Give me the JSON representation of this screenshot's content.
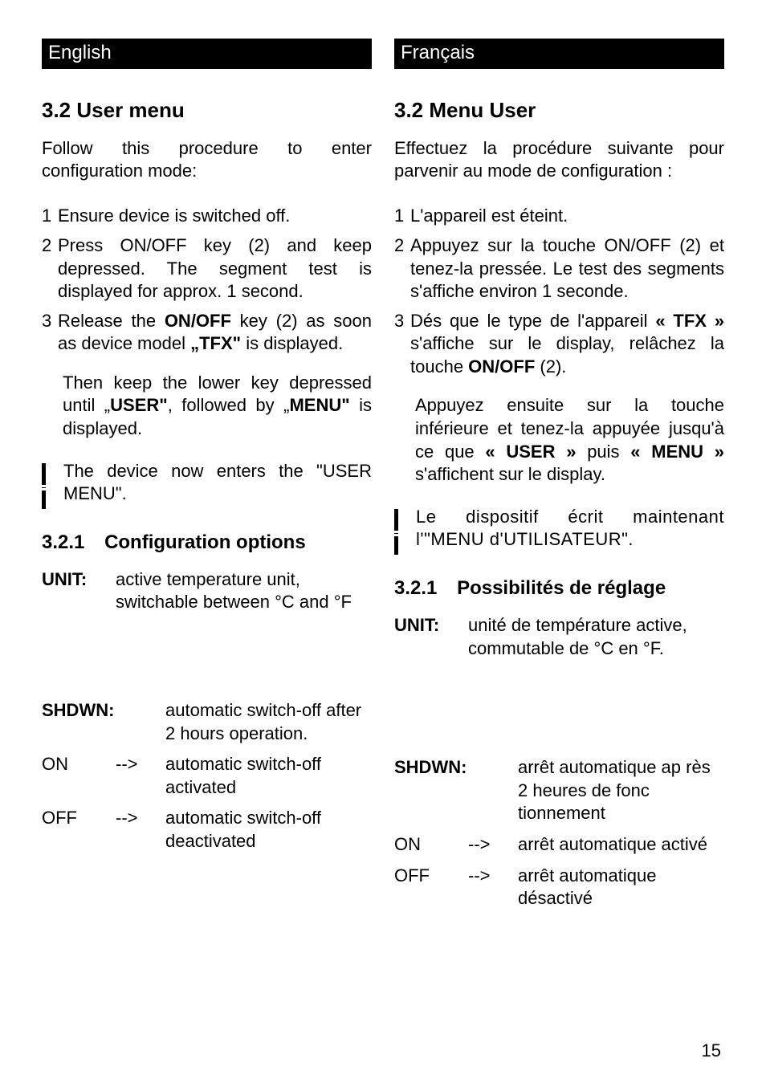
{
  "left": {
    "lang": "English",
    "h2": "3.2  User menu",
    "intro": "Follow this procedure to enter configuration mode:",
    "steps": [
      {
        "n": "1",
        "t": "Ensure device is switched off."
      },
      {
        "n": "2",
        "t": "Press ON/OFF key (2) and keep depressed. The segment test is displayed for approx. 1 second."
      },
      {
        "n": "3",
        "t": "Release the <b>ON/OFF</b> key (2) as soon as device model <b>„TFX\"</b> is displayed."
      }
    ],
    "subpara": "Then keep the lower key depressed until „<b>USER\"</b>, followed by „<b>MENU\"</b> is displayed.",
    "note": "The device now enters the \"USER MENU\".",
    "h3num": "3.2.1",
    "h3": "Configuration options",
    "unit_label": "UNIT:",
    "unit_val": "active temperature unit, switchable between °C and °F",
    "shdwn_label": "SHDWN:",
    "shdwn_val": "automatic switch-off after 2 hours operation.",
    "on_label": "ON",
    "arrow": "-->",
    "on_val": "automatic switch-off activated",
    "off_label": "OFF",
    "off_val": "automatic switch-off deactivated"
  },
  "right": {
    "lang": "Français",
    "h2": "3.2  Menu User",
    "intro": "Effectuez la procédure suivante pour parvenir au mode de configuration :",
    "steps": [
      {
        "n": "1",
        "t": "L'appareil est éteint."
      },
      {
        "n": "2",
        "t": "Appuyez sur la touche ON/OFF (2) et tenez-la pressée. Le test des segments s'affiche environ 1 seconde."
      },
      {
        "n": "3",
        "t": "Dés que le type de l'appareil <b>« TFX »</b> s'affiche sur le display, relâchez la touche <b>ON/OFF</b> (2)."
      }
    ],
    "subpara": "Appuyez ensuite sur la touche inférieure et tenez-la appuyée jusqu'à ce que <b>« USER »</b> puis <b>« MENU »</b> s'affichent sur le display.",
    "note": "Le dispositif écrit maintenant l'\"MENU d'UTILISATEUR\".",
    "h3num": "3.2.1",
    "h3": "Possibilités de réglage",
    "unit_label": "UNIT:",
    "unit_val": "unité de température active, commutable de °C en °F.",
    "shdwn_label": "SHDWN:",
    "shdwn_val": "arrêt automatique ap rès 2 heures de  fonc tionnement",
    "on_label": "ON",
    "arrow": "-->",
    "on_val": "arrêt automatique activé",
    "off_label": "OFF",
    "off_val": "arrêt automatique désactivé"
  },
  "page": "15"
}
